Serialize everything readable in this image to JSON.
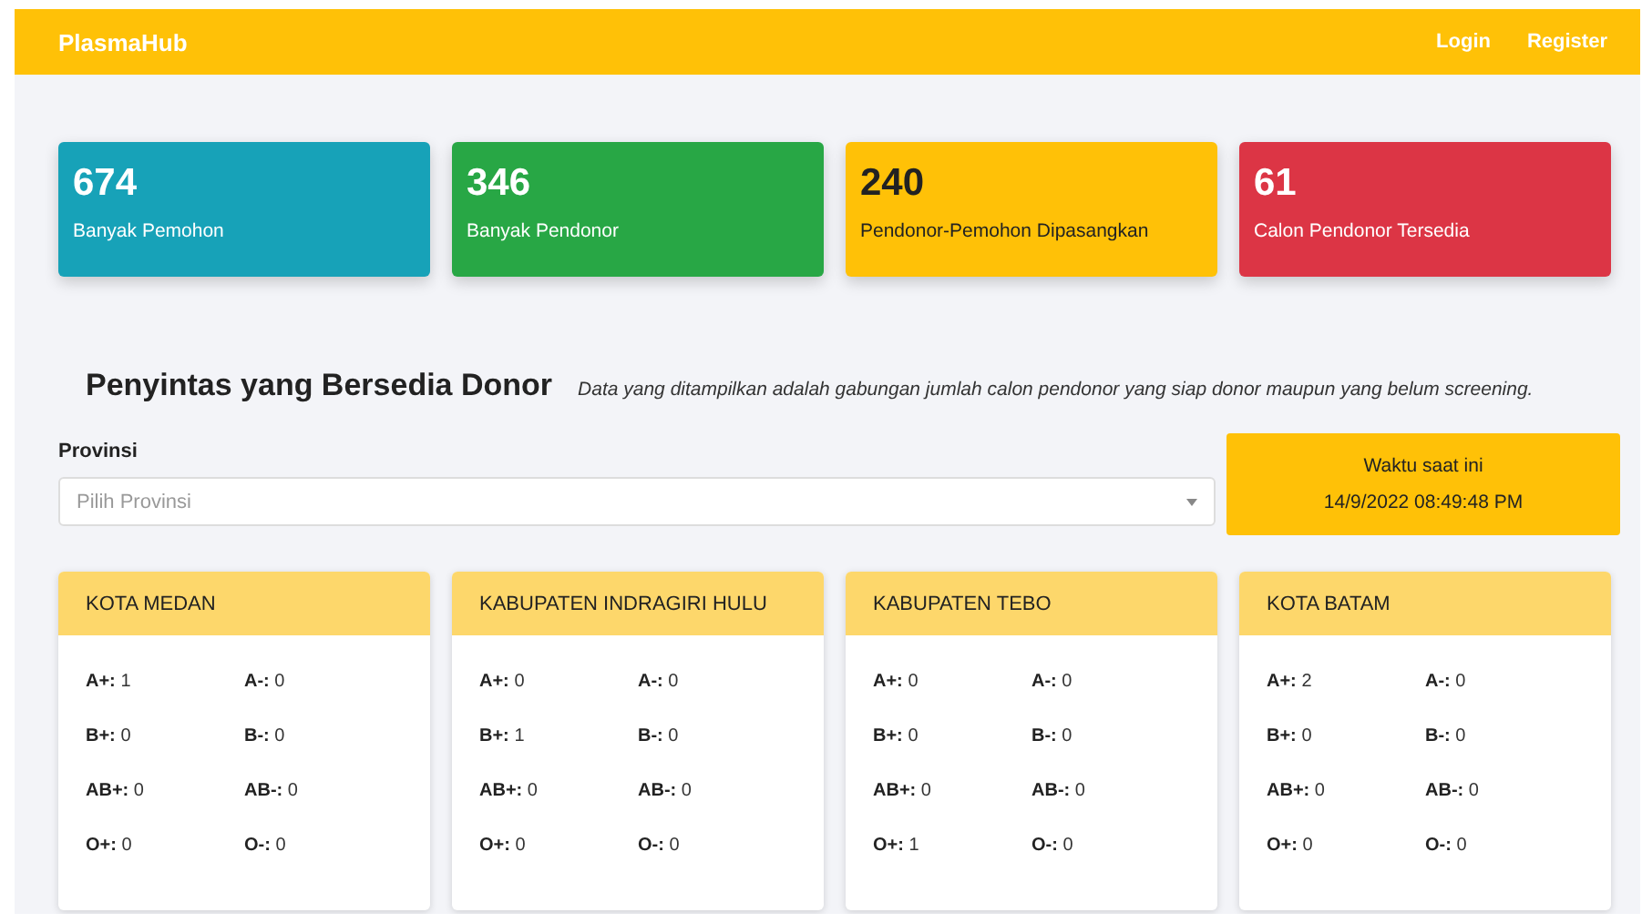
{
  "navbar": {
    "brand": "PlasmaHub",
    "links": [
      "Login",
      "Register"
    ]
  },
  "stats": [
    {
      "value": "674",
      "label": "Banyak Pemohon",
      "color": "#17a2b8"
    },
    {
      "value": "346",
      "label": "Banyak Pendonor",
      "color": "#28a745"
    },
    {
      "value": "240",
      "label": "Pendonor-Pemohon Dipasangkan",
      "color": "#ffc107"
    },
    {
      "value": "61",
      "label": "Calon Pendonor Tersedia",
      "color": "#dc3545"
    }
  ],
  "section": {
    "title": "Penyintas yang Bersedia Donor",
    "note": "Data yang ditampilkan adalah gabungan jumlah calon pendonor yang siap donor maupun yang belum screening."
  },
  "filter": {
    "label": "Provinsi",
    "placeholder": "Pilih Provinsi"
  },
  "clock": {
    "label": "Waktu saat ini",
    "value": "14/9/2022 08:49:48 PM"
  },
  "regions": [
    {
      "name": "KOTA MEDAN",
      "counts": [
        {
          "type": "A+:",
          "value": "1"
        },
        {
          "type": "A-:",
          "value": "0"
        },
        {
          "type": "B+:",
          "value": "0"
        },
        {
          "type": "B-:",
          "value": "0"
        },
        {
          "type": "AB+:",
          "value": "0"
        },
        {
          "type": "AB-:",
          "value": "0"
        },
        {
          "type": "O+:",
          "value": "0"
        },
        {
          "type": "O-:",
          "value": "0"
        }
      ]
    },
    {
      "name": "KABUPATEN INDRAGIRI HULU",
      "counts": [
        {
          "type": "A+:",
          "value": "0"
        },
        {
          "type": "A-:",
          "value": "0"
        },
        {
          "type": "B+:",
          "value": "1"
        },
        {
          "type": "B-:",
          "value": "0"
        },
        {
          "type": "AB+:",
          "value": "0"
        },
        {
          "type": "AB-:",
          "value": "0"
        },
        {
          "type": "O+:",
          "value": "0"
        },
        {
          "type": "O-:",
          "value": "0"
        }
      ]
    },
    {
      "name": "KABUPATEN TEBO",
      "counts": [
        {
          "type": "A+:",
          "value": "0"
        },
        {
          "type": "A-:",
          "value": "0"
        },
        {
          "type": "B+:",
          "value": "0"
        },
        {
          "type": "B-:",
          "value": "0"
        },
        {
          "type": "AB+:",
          "value": "0"
        },
        {
          "type": "AB-:",
          "value": "0"
        },
        {
          "type": "O+:",
          "value": "1"
        },
        {
          "type": "O-:",
          "value": "0"
        }
      ]
    },
    {
      "name": "KOTA BATAM",
      "counts": [
        {
          "type": "A+:",
          "value": "2"
        },
        {
          "type": "A-:",
          "value": "0"
        },
        {
          "type": "B+:",
          "value": "0"
        },
        {
          "type": "B-:",
          "value": "0"
        },
        {
          "type": "AB+:",
          "value": "0"
        },
        {
          "type": "AB-:",
          "value": "0"
        },
        {
          "type": "O+:",
          "value": "0"
        },
        {
          "type": "O-:",
          "value": "0"
        }
      ]
    }
  ]
}
